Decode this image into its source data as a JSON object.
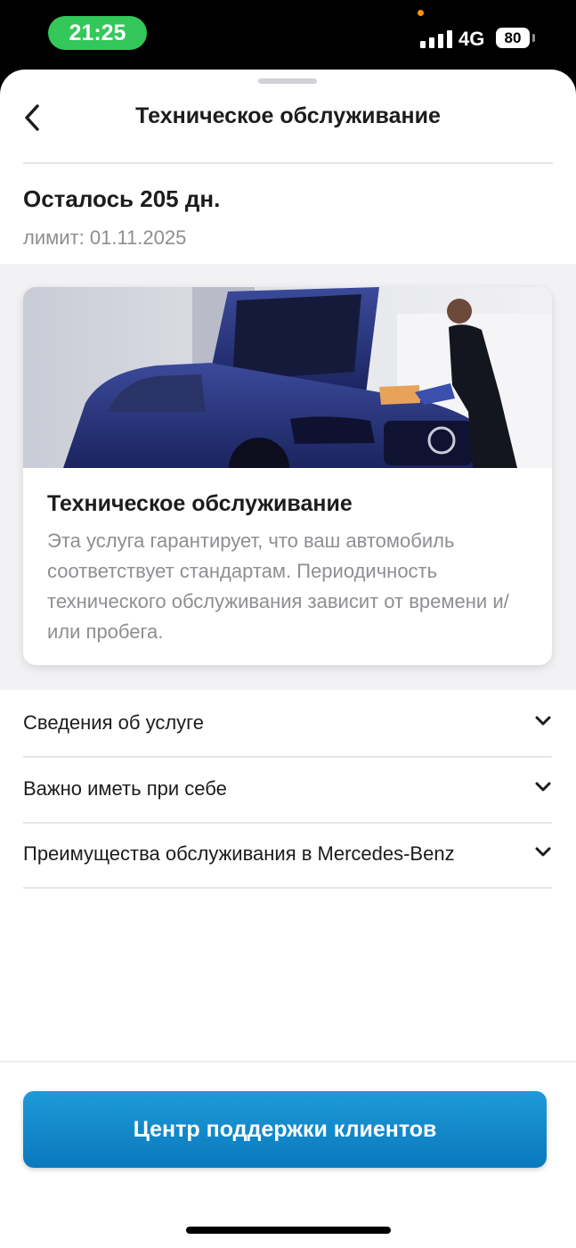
{
  "status_bar": {
    "time": "21:25",
    "network": "4G",
    "battery": "80"
  },
  "header": {
    "title": "Техническое обслуживание"
  },
  "summary": {
    "remaining": "Осталось 205 дн.",
    "limit": "лимит: 01.11.2025"
  },
  "card": {
    "title": "Техническое обслуживание",
    "description": "Эта услуга гарантирует, что ваш автомобиль соответствует стандартам. Периодичность технического обслуживания зависит от времени и/или пробега."
  },
  "accordion": [
    {
      "label": "Сведения об услуге"
    },
    {
      "label": "Важно иметь при себе"
    },
    {
      "label": "Преимущества обслуживания в Mercedes-Benz"
    }
  ],
  "cta": {
    "label": "Центр поддержки клиентов"
  },
  "colors": {
    "accent": "#0a79bd",
    "status_pill": "#34c759"
  },
  "icons": [
    "back-arrow-icon",
    "chevron-down-icon",
    "signal-icon",
    "battery-icon"
  ]
}
